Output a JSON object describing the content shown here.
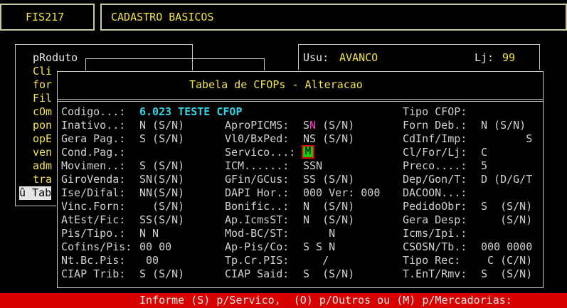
{
  "header": {
    "code": "FIS217",
    "title": "CADASTRO BASICOS"
  },
  "user_bar": {
    "user_label": "Usu:",
    "user": "AVANCO",
    "store_label": "Lj:",
    "store": "99"
  },
  "menu": {
    "items": [
      "pRoduto",
      "Cli",
      "for",
      "Fil",
      "cOm",
      "pon",
      "opE",
      "ven",
      "adm",
      "tra"
    ],
    "selected": "û Tab"
  },
  "dialog": {
    "title": "Tabela de CFOPs - Alteracao",
    "codigo_label": "Codigo...:",
    "codigo_value": "6.023 TESTE CFOP",
    "col1": [
      {
        "label": "Inativo..:",
        "value": "N (S/N)"
      },
      {
        "label": "Gera Pag.:",
        "value": "S (S/N)"
      },
      {
        "label": "Cond.Pag.:",
        "value": ""
      },
      {
        "label": "Movimen..:",
        "value": "S (S/N)"
      },
      {
        "label": "GiroVenda:",
        "value": "SN(S/N)"
      },
      {
        "label": "Ise/Difal:",
        "value": "NN(S/N)"
      },
      {
        "label": "Vinc.Forn:",
        "value": "  (S/N)"
      },
      {
        "label": "AtEst/Fic:",
        "value": "SS(S/N)"
      },
      {
        "label": "Pis/Tipo.:",
        "value": "N N"
      },
      {
        "label": "Cofins/Pis:",
        "value": "00 00"
      },
      {
        "label": "Nt.Bc.Pis:",
        "value": " 00"
      },
      {
        "label": "CIAP Trib:",
        "value": "S (S/N)"
      }
    ],
    "col2_inline": {
      "label": "AproPICMS:",
      "s": "S",
      "n": "N",
      "rest": " (S/N)"
    },
    "col2": [
      {
        "label": "Vl0/BxPed:",
        "value": "NS (S/N)"
      },
      {
        "label": "Servico...:",
        "value": ""
      },
      {
        "label": "ICM......:",
        "value": "SSN"
      },
      {
        "label": "GFin/GCus:",
        "value": "SS (S/N)"
      },
      {
        "label": "DAPI Hor.:",
        "value": "000 Ver: 000"
      },
      {
        "label": "Bonific..:",
        "value": "N  (S/N)"
      },
      {
        "label": "Ap.IcmsST:",
        "value": "N  (S/N)"
      },
      {
        "label": "Mod-BC/ST:",
        "value": "    N"
      },
      {
        "label": "Ap-Pis/Co:",
        "value": "S S N"
      },
      {
        "label": "Tp.Cr.PIS:",
        "value": "   /"
      },
      {
        "label": "CIAP Said:",
        "value": "S  (S/N)"
      }
    ],
    "servico_value": "M",
    "col3": [
      {
        "label": "Tipo CFOP:",
        "value": ""
      },
      {
        "label": "Forn Deb.:",
        "value": "N (S/N)"
      },
      {
        "label": "CdInf/Imp:",
        "value": "       S"
      },
      {
        "label": "Cl/For/Lj:",
        "value": "C"
      },
      {
        "label": "Preco....:",
        "value": "5"
      },
      {
        "label": "Dep/Gon/T:",
        "value": "D (D/G/T"
      },
      {
        "label": "DACOON...:",
        "value": ""
      },
      {
        "label": "PedidoObr:",
        "value": "S  (S/N)"
      },
      {
        "label": "Gera Desp:",
        "value": "   (S/N)"
      },
      {
        "label": "Icms/Ipi.:",
        "value": ""
      },
      {
        "label": "CSOSN/Tb.:",
        "value": "000 0000"
      },
      {
        "label": "Tipo Rec:",
        "value": " C (C/N)"
      },
      {
        "label": "T.EnT/Rmv:",
        "value": "S  (S/N)"
      }
    ]
  },
  "status": "Informe (S) p/Servico,  (O) p/Outros ou (M) p/Mercadorias:",
  "colors": {
    "status_bg": "#d80000",
    "highlight_bg": "#18c818",
    "accent": "#f2e34a",
    "codigo": "#2fd4e8"
  }
}
